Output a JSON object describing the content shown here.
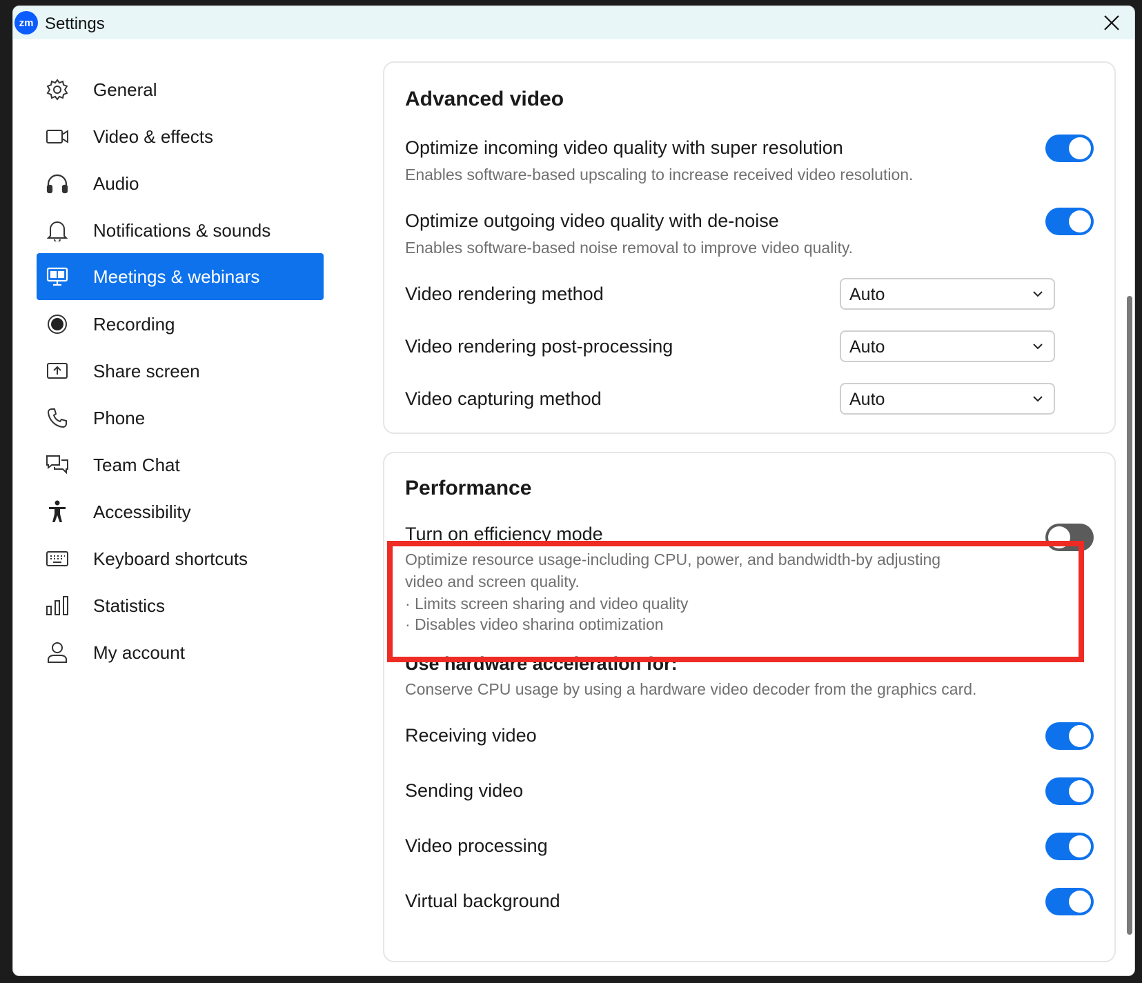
{
  "window": {
    "title": "Settings",
    "logo_text": "zm"
  },
  "sidebar": {
    "items": [
      {
        "label": "General",
        "icon": "gear-icon"
      },
      {
        "label": "Video & effects",
        "icon": "video-camera-icon"
      },
      {
        "label": "Audio",
        "icon": "headphones-icon"
      },
      {
        "label": "Notifications & sounds",
        "icon": "bell-icon"
      },
      {
        "label": "Meetings & webinars",
        "icon": "meetings-icon",
        "active": true
      },
      {
        "label": "Recording",
        "icon": "record-icon"
      },
      {
        "label": "Share screen",
        "icon": "share-screen-icon"
      },
      {
        "label": "Phone",
        "icon": "phone-icon"
      },
      {
        "label": "Team Chat",
        "icon": "chat-icon"
      },
      {
        "label": "Accessibility",
        "icon": "accessibility-icon"
      },
      {
        "label": "Keyboard shortcuts",
        "icon": "keyboard-icon"
      },
      {
        "label": "Statistics",
        "icon": "statistics-icon"
      },
      {
        "label": "My account",
        "icon": "account-icon"
      }
    ]
  },
  "advanced_video": {
    "title": "Advanced video",
    "super_resolution": {
      "title": "Optimize incoming video quality with super resolution",
      "desc": "Enables software-based upscaling to increase received video resolution.",
      "enabled": true
    },
    "denoise": {
      "title": "Optimize outgoing video quality with de-noise",
      "desc": "Enables software-based noise removal to improve video quality.",
      "enabled": true
    },
    "rendering_method": {
      "label": "Video rendering method",
      "value": "Auto"
    },
    "post_processing": {
      "label": "Video rendering post-processing",
      "value": "Auto"
    },
    "capturing_method": {
      "label": "Video capturing method",
      "value": "Auto"
    }
  },
  "performance": {
    "title": "Performance",
    "efficiency": {
      "title": "Turn on efficiency mode",
      "desc_line1": "Optimize resource usage-including CPU, power, and bandwidth-by adjusting",
      "desc_line2": "video and screen quality.",
      "bullet1": "· Limits screen sharing and video quality",
      "bullet2": "· Disables video sharing optimization",
      "enabled": false
    },
    "hw_accel": {
      "title": "Use hardware acceleration for:",
      "desc": "Conserve CPU usage by using a hardware video decoder from the graphics card.",
      "receiving": {
        "label": "Receiving video",
        "enabled": true
      },
      "sending": {
        "label": "Sending video",
        "enabled": true
      },
      "processing": {
        "label": "Video processing",
        "enabled": true
      },
      "virtual_bg": {
        "label": "Virtual background",
        "enabled": true
      }
    }
  },
  "colors": {
    "accent": "#0e72ed",
    "highlight": "#ee2b24",
    "toggle_off": "#5b5b5b"
  }
}
